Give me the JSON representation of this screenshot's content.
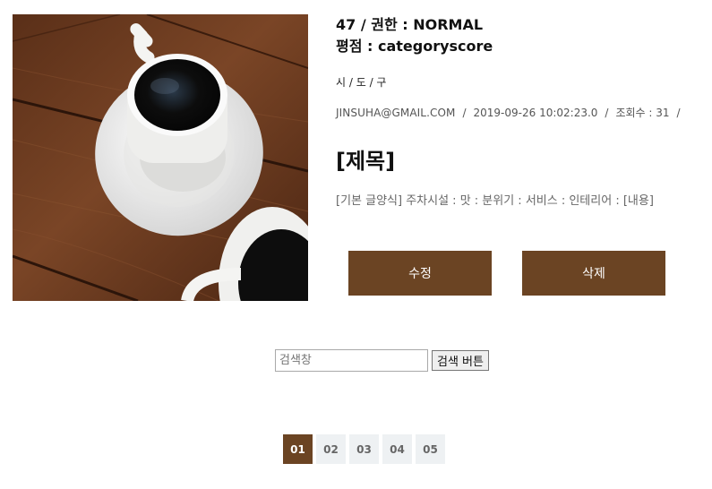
{
  "post": {
    "number_authority": "47 / 권한 : NORMAL",
    "score": "평점 : categoryscore",
    "location": "시 / 도 / 구",
    "meta": {
      "email": "JINSUHA@GMAIL.COM",
      "datetime": "2019-09-26 10:02:23.0",
      "views": "조회수 : 31",
      "separator": "/"
    },
    "title": "[제목]",
    "body": "[기본 글양식] 주차시설 : 맛 : 분위기 : 서비스 : 인테리어 : [내용]"
  },
  "photo": {
    "description": "coffee-cups-on-wooden-table",
    "colors": {
      "wood": "#6e3c1f",
      "cup": "#f2f2f0",
      "coffee": "#0e0d0c"
    }
  },
  "actions": {
    "edit_label": "수정",
    "delete_label": "삭제"
  },
  "search": {
    "placeholder": "검색창",
    "value": "",
    "button_label": "검색 버튼"
  },
  "pagination": {
    "pages": [
      "01",
      "02",
      "03",
      "04",
      "05"
    ],
    "active": "01"
  },
  "colors": {
    "accent": "#6b4423",
    "page_inactive_bg": "#eef1f3"
  }
}
